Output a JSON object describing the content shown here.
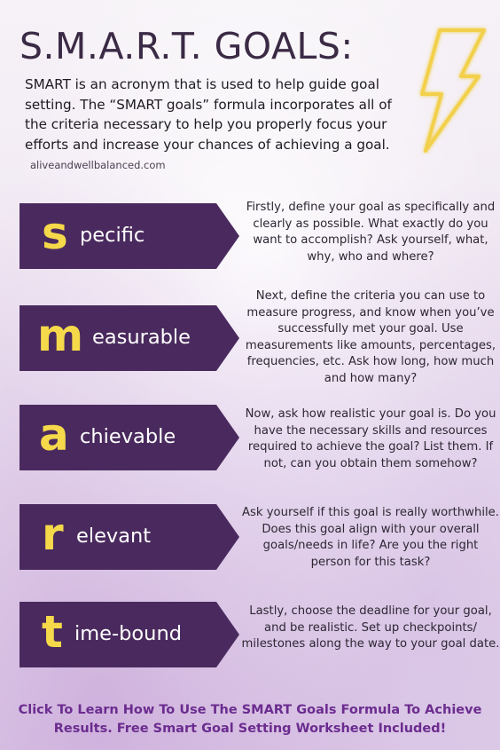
{
  "header": {
    "title": "S.M.A.R.T. GOALS:",
    "intro": "SMART is an acronym that is used to help guide goal setting. The “SMART goals” formula incorporates all of the criteria necessary to help you properly focus your efforts and increase your chances of achieving a goal.",
    "website": "aliveandwellbalanced.com"
  },
  "items": [
    {
      "letter": "s",
      "rest": "pecific",
      "description": "Firstly, define your goal as specifically and clearly as possible. What exactly do you want to accomplish? Ask yourself, what, why, who and where?"
    },
    {
      "letter": "m",
      "rest": "easurable",
      "description": "Next, define the criteria you can use to measure progress, and know when you’ve successfully met your goal. Use measurements like amounts, percentages, frequencies, etc. Ask how long, how much and how many?"
    },
    {
      "letter": "a",
      "rest": "chievable",
      "description": "Now, ask how realistic your goal is. Do you have the necessary skills and resources required to achieve the goal? List them. If not, can you obtain them somehow?"
    },
    {
      "letter": "r",
      "rest": "elevant",
      "description": "Ask yourself if this goal is really worthwhile. Does this goal align with your overall goals/needs in life? Are you the right person for this task?"
    },
    {
      "letter": "t",
      "rest": "ime-bound",
      "description": "Lastly, choose the deadline for your goal, and be realistic. Set up checkpoints/ milestones along the way to your goal date."
    }
  ],
  "cta": "Click To Learn How To Use The SMART Goals Formula To Achieve Results. Free Smart Goal Setting Worksheet Included!",
  "colors": {
    "banner": "#4a2a5e",
    "banner_fold": "#2a1636",
    "accent_letter": "#f5d94a",
    "bolt": "#f2d04b",
    "cta": "#6b2c8f"
  },
  "icons": {
    "decoration": "lightning-bolt-icon"
  }
}
